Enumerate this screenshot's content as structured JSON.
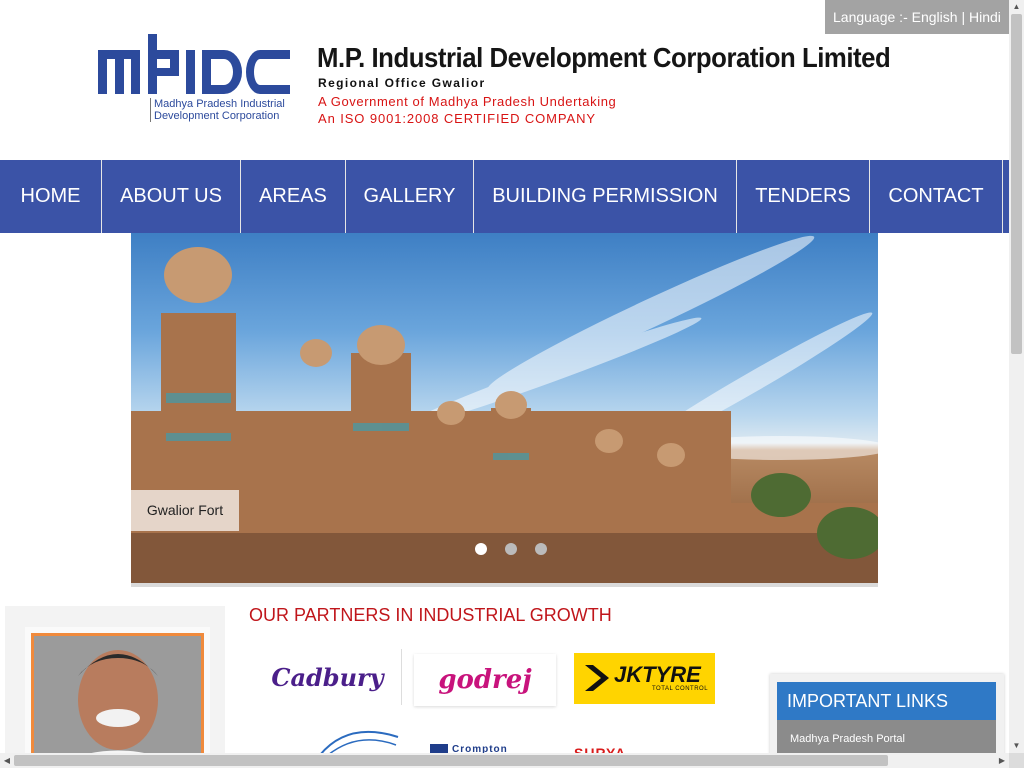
{
  "language": {
    "label": "Language :-",
    "options": [
      "English",
      "Hindi"
    ],
    "separator": "|"
  },
  "header": {
    "logo_lines": [
      "Madhya Pradesh Industrial",
      "Development Corporation"
    ],
    "title": "M.P. Industrial Development Corporation Limited",
    "office": "Regional Office Gwalior",
    "tagline": "A Government of Madhya Pradesh Undertaking",
    "certification": "An ISO 9001:2008 CERTIFIED COMPANY"
  },
  "nav": {
    "items": [
      {
        "label": "HOME"
      },
      {
        "label": "ABOUT US"
      },
      {
        "label": "AREAS"
      },
      {
        "label": "GALLERY"
      },
      {
        "label": "BUILDING PERMISSION"
      },
      {
        "label": "TENDERS"
      },
      {
        "label": "CONTACT"
      }
    ]
  },
  "slider": {
    "caption": "Gwalior Fort",
    "slide_count": 3,
    "active_slide": 1
  },
  "partners": {
    "title": "OUR PARTNERS IN INDUSTRIAL GROWTH",
    "logos": [
      "Cadbury",
      "godrej",
      "JKTYRE",
      "TOTAL CONTROL",
      "Crompton",
      "SURYA"
    ]
  },
  "important_links": {
    "title": "IMPORTANT LINKS",
    "items": [
      "Madhya Pradesh Portal"
    ]
  },
  "colors": {
    "nav_bg": "#3b53a7",
    "title_red": "#c0161b",
    "links_head": "#2f79c6",
    "logo_blue": "#2c4a9c"
  }
}
